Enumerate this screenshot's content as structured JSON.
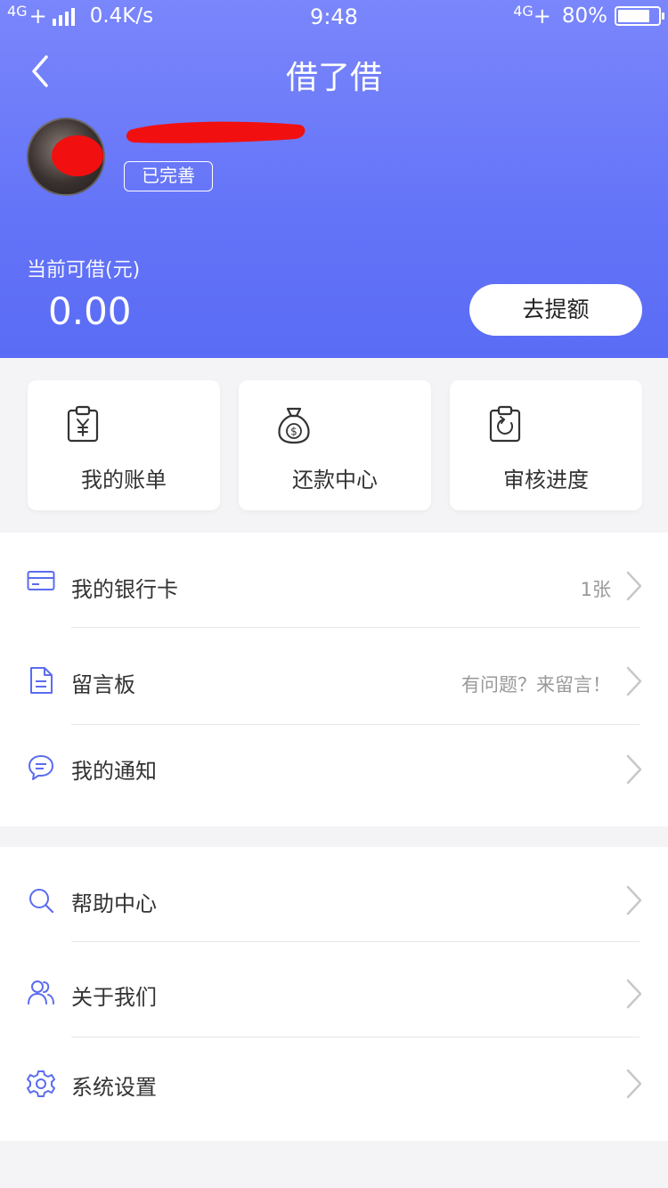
{
  "status_bar": {
    "network": "4G",
    "plus": "+",
    "speed": "0.4K/s",
    "time": "9:48",
    "network_right": "4G",
    "battery_pct": "80%",
    "battery_level": 0.8
  },
  "nav": {
    "title": "借了借",
    "back_icon": "chevron-left-icon"
  },
  "profile": {
    "badge": "已完善"
  },
  "credit": {
    "label": "当前可借(元)",
    "amount": "0.00",
    "raise_button": "去提额"
  },
  "cards": [
    {
      "label": "我的账单",
      "icon": "bill-clipboard-icon"
    },
    {
      "label": "还款中心",
      "icon": "money-bag-icon"
    },
    {
      "label": "审核进度",
      "icon": "refresh-clipboard-icon"
    }
  ],
  "section1": [
    {
      "label": "我的银行卡",
      "value": "1张",
      "icon": "bank-card-icon"
    },
    {
      "label": "留言板",
      "value": "有问题？来留言！",
      "icon": "document-icon"
    },
    {
      "label": "我的通知",
      "value": "",
      "icon": "chat-bubble-icon"
    }
  ],
  "section2": [
    {
      "label": "帮助中心",
      "icon": "search-icon"
    },
    {
      "label": "关于我们",
      "icon": "users-icon"
    },
    {
      "label": "系统设置",
      "icon": "gear-icon"
    }
  ],
  "colors": {
    "header_top": "#7a86fb",
    "header_bottom": "#5a6cf5",
    "accent": "#5b6cf0",
    "background": "#f4f4f6",
    "redaction": "#f20f0f"
  }
}
